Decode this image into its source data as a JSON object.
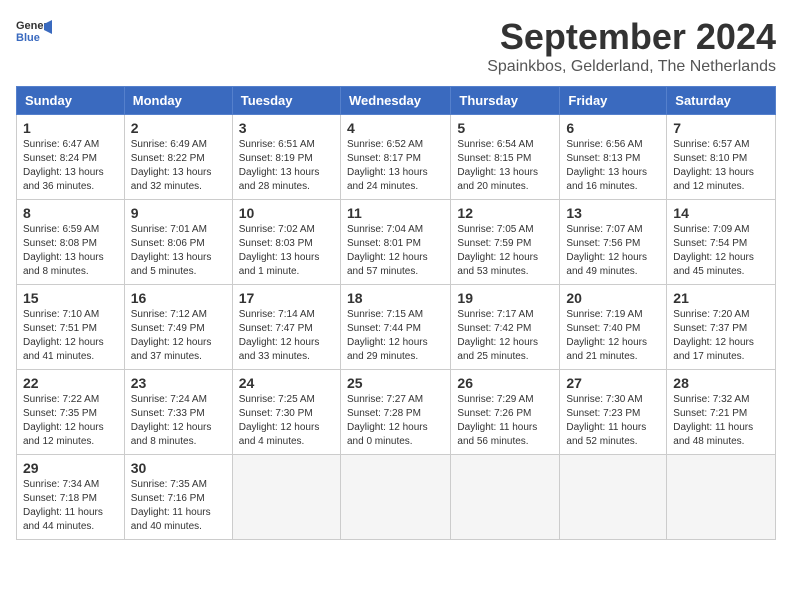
{
  "header": {
    "logo_line1": "General",
    "logo_line2": "Blue",
    "title": "September 2024",
    "subtitle": "Spainkbos, Gelderland, The Netherlands"
  },
  "days_of_week": [
    "Sunday",
    "Monday",
    "Tuesday",
    "Wednesday",
    "Thursday",
    "Friday",
    "Saturday"
  ],
  "weeks": [
    [
      {
        "day": "1",
        "info": "Sunrise: 6:47 AM\nSunset: 8:24 PM\nDaylight: 13 hours\nand 36 minutes."
      },
      {
        "day": "2",
        "info": "Sunrise: 6:49 AM\nSunset: 8:22 PM\nDaylight: 13 hours\nand 32 minutes."
      },
      {
        "day": "3",
        "info": "Sunrise: 6:51 AM\nSunset: 8:19 PM\nDaylight: 13 hours\nand 28 minutes."
      },
      {
        "day": "4",
        "info": "Sunrise: 6:52 AM\nSunset: 8:17 PM\nDaylight: 13 hours\nand 24 minutes."
      },
      {
        "day": "5",
        "info": "Sunrise: 6:54 AM\nSunset: 8:15 PM\nDaylight: 13 hours\nand 20 minutes."
      },
      {
        "day": "6",
        "info": "Sunrise: 6:56 AM\nSunset: 8:13 PM\nDaylight: 13 hours\nand 16 minutes."
      },
      {
        "day": "7",
        "info": "Sunrise: 6:57 AM\nSunset: 8:10 PM\nDaylight: 13 hours\nand 12 minutes."
      }
    ],
    [
      {
        "day": "8",
        "info": "Sunrise: 6:59 AM\nSunset: 8:08 PM\nDaylight: 13 hours\nand 8 minutes."
      },
      {
        "day": "9",
        "info": "Sunrise: 7:01 AM\nSunset: 8:06 PM\nDaylight: 13 hours\nand 5 minutes."
      },
      {
        "day": "10",
        "info": "Sunrise: 7:02 AM\nSunset: 8:03 PM\nDaylight: 13 hours\nand 1 minute."
      },
      {
        "day": "11",
        "info": "Sunrise: 7:04 AM\nSunset: 8:01 PM\nDaylight: 12 hours\nand 57 minutes."
      },
      {
        "day": "12",
        "info": "Sunrise: 7:05 AM\nSunset: 7:59 PM\nDaylight: 12 hours\nand 53 minutes."
      },
      {
        "day": "13",
        "info": "Sunrise: 7:07 AM\nSunset: 7:56 PM\nDaylight: 12 hours\nand 49 minutes."
      },
      {
        "day": "14",
        "info": "Sunrise: 7:09 AM\nSunset: 7:54 PM\nDaylight: 12 hours\nand 45 minutes."
      }
    ],
    [
      {
        "day": "15",
        "info": "Sunrise: 7:10 AM\nSunset: 7:51 PM\nDaylight: 12 hours\nand 41 minutes."
      },
      {
        "day": "16",
        "info": "Sunrise: 7:12 AM\nSunset: 7:49 PM\nDaylight: 12 hours\nand 37 minutes."
      },
      {
        "day": "17",
        "info": "Sunrise: 7:14 AM\nSunset: 7:47 PM\nDaylight: 12 hours\nand 33 minutes."
      },
      {
        "day": "18",
        "info": "Sunrise: 7:15 AM\nSunset: 7:44 PM\nDaylight: 12 hours\nand 29 minutes."
      },
      {
        "day": "19",
        "info": "Sunrise: 7:17 AM\nSunset: 7:42 PM\nDaylight: 12 hours\nand 25 minutes."
      },
      {
        "day": "20",
        "info": "Sunrise: 7:19 AM\nSunset: 7:40 PM\nDaylight: 12 hours\nand 21 minutes."
      },
      {
        "day": "21",
        "info": "Sunrise: 7:20 AM\nSunset: 7:37 PM\nDaylight: 12 hours\nand 17 minutes."
      }
    ],
    [
      {
        "day": "22",
        "info": "Sunrise: 7:22 AM\nSunset: 7:35 PM\nDaylight: 12 hours\nand 12 minutes."
      },
      {
        "day": "23",
        "info": "Sunrise: 7:24 AM\nSunset: 7:33 PM\nDaylight: 12 hours\nand 8 minutes."
      },
      {
        "day": "24",
        "info": "Sunrise: 7:25 AM\nSunset: 7:30 PM\nDaylight: 12 hours\nand 4 minutes."
      },
      {
        "day": "25",
        "info": "Sunrise: 7:27 AM\nSunset: 7:28 PM\nDaylight: 12 hours\nand 0 minutes."
      },
      {
        "day": "26",
        "info": "Sunrise: 7:29 AM\nSunset: 7:26 PM\nDaylight: 11 hours\nand 56 minutes."
      },
      {
        "day": "27",
        "info": "Sunrise: 7:30 AM\nSunset: 7:23 PM\nDaylight: 11 hours\nand 52 minutes."
      },
      {
        "day": "28",
        "info": "Sunrise: 7:32 AM\nSunset: 7:21 PM\nDaylight: 11 hours\nand 48 minutes."
      }
    ],
    [
      {
        "day": "29",
        "info": "Sunrise: 7:34 AM\nSunset: 7:18 PM\nDaylight: 11 hours\nand 44 minutes."
      },
      {
        "day": "30",
        "info": "Sunrise: 7:35 AM\nSunset: 7:16 PM\nDaylight: 11 hours\nand 40 minutes."
      },
      {
        "day": "",
        "info": ""
      },
      {
        "day": "",
        "info": ""
      },
      {
        "day": "",
        "info": ""
      },
      {
        "day": "",
        "info": ""
      },
      {
        "day": "",
        "info": ""
      }
    ]
  ]
}
